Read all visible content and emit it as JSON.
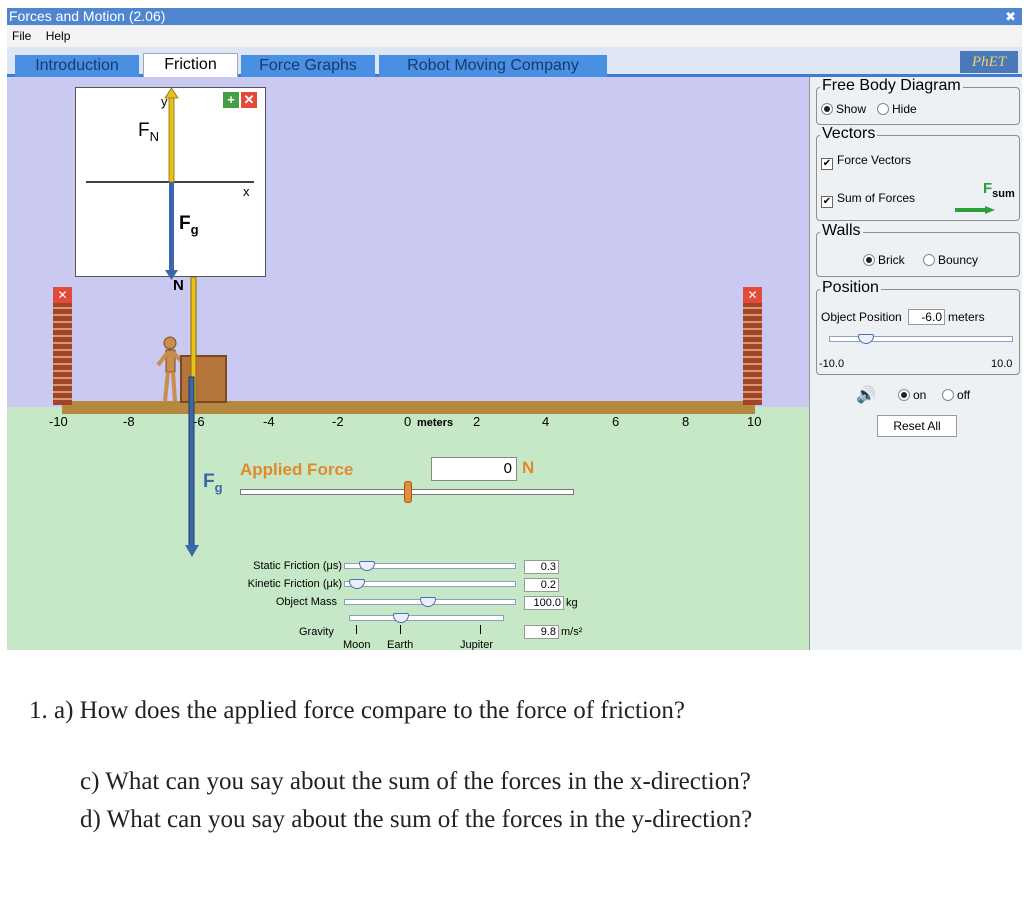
{
  "window": {
    "title": "Forces and Motion (2.06)",
    "close_glyph": "✖"
  },
  "menu": {
    "file": "File",
    "help": "Help"
  },
  "tabs": [
    {
      "label": "Introduction",
      "active": false
    },
    {
      "label": "Friction",
      "active": true
    },
    {
      "label": "Force Graphs",
      "active": false
    },
    {
      "label": "Robot Moving Company",
      "active": false
    }
  ],
  "logo": "PhET",
  "fbd": {
    "y_label": "y",
    "x_label": "x",
    "fn_label": "F",
    "fn_sub": "N",
    "fg_label": "F",
    "fg_sub": "g",
    "zoom_in": "+",
    "close": "✕"
  },
  "scene": {
    "axis_ticks": [
      "-10",
      "-8",
      "-6",
      "-4",
      "-2",
      "0",
      "2",
      "4",
      "6",
      "8",
      "10"
    ],
    "axis_unit": "meters",
    "n_label": "N",
    "fg_label": "F",
    "fg_sub": "g",
    "wall_close": "✕"
  },
  "applied_force": {
    "label": "Applied Force",
    "value": "0",
    "unit": "N"
  },
  "params": {
    "static_friction": {
      "label": "Static Friction (μs)",
      "value": "0.3"
    },
    "kinetic_friction": {
      "label": "Kinetic Friction (μk)",
      "value": "0.2"
    },
    "object_mass": {
      "label": "Object Mass",
      "value": "100.0",
      "unit": "kg"
    },
    "gravity": {
      "label": "Gravity",
      "value": "9.8",
      "unit": "m/s²",
      "marks": [
        "Moon",
        "Earth",
        "Jupiter"
      ]
    }
  },
  "panel": {
    "fbd_title": "Free Body Diagram",
    "fbd_show": "Show",
    "fbd_hide": "Hide",
    "vectors_title": "Vectors",
    "force_vectors": "Force Vectors",
    "sum_forces": "Sum of Forces",
    "fsum_label": "F",
    "fsum_sub": "sum",
    "walls_title": "Walls",
    "brick": "Brick",
    "bouncy": "Bouncy",
    "position_title": "Position",
    "object_position_label": "Object Position",
    "object_position_value": "-6.0",
    "object_position_unit": "meters",
    "pos_min": "-10.0",
    "pos_max": "10.0",
    "sound_on": "on",
    "sound_off": "off",
    "reset": "Reset All"
  },
  "colors": {
    "fn": "#e8c11a",
    "fg": "#3d67a8",
    "sum": "#2e9e3a",
    "applied": "#e08a2a"
  },
  "questions": [
    "1.  a) How does the applied force compare to the force of friction?",
    "c) What can you say about the sum of the forces in the x-direction?",
    "d) What can you say about the sum of the forces in the y-direction?"
  ]
}
